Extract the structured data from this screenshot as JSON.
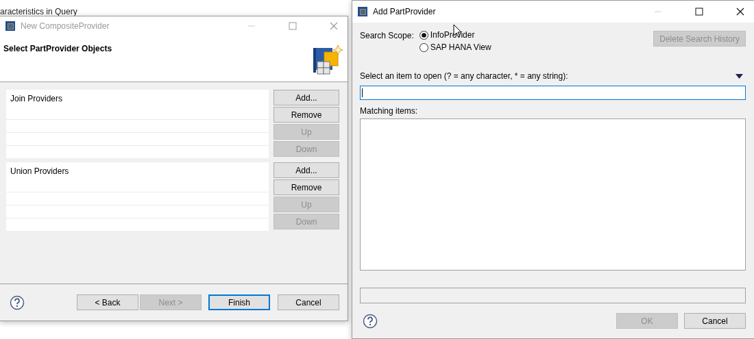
{
  "background_text": "aracteristics in Query",
  "wizard": {
    "title": "New CompositeProvider",
    "active": false,
    "heading": "Select PartProvider Objects",
    "sections": [
      {
        "label": "Join Providers",
        "buttons": [
          {
            "label": "Add...",
            "disabled": false
          },
          {
            "label": "Remove",
            "disabled": false
          },
          {
            "label": "Up",
            "disabled": true
          },
          {
            "label": "Down",
            "disabled": true
          }
        ]
      },
      {
        "label": "Union Providers",
        "buttons": [
          {
            "label": "Add...",
            "disabled": false
          },
          {
            "label": "Remove",
            "disabled": false
          },
          {
            "label": "Up",
            "disabled": true
          },
          {
            "label": "Down",
            "disabled": true
          }
        ]
      }
    ],
    "buttons": [
      {
        "label": "< Back",
        "disabled": false,
        "default": false
      },
      {
        "label": "Next >",
        "disabled": true,
        "default": false
      },
      {
        "label": "Finish",
        "disabled": false,
        "default": true
      },
      {
        "label": "Cancel",
        "disabled": false,
        "default": false
      }
    ]
  },
  "dialog": {
    "title": "Add PartProvider",
    "active": true,
    "search_scope_label": "Search Scope:",
    "scopes": [
      {
        "label": "InfoProvider",
        "selected": true
      },
      {
        "label": "SAP HANA View",
        "selected": false
      }
    ],
    "delete_history": {
      "label": "Delete Search History",
      "disabled": true
    },
    "pattern_label": "Select an item to open (? = any character, * = any string):",
    "matching_label": "Matching items:",
    "buttons": [
      {
        "label": "OK",
        "disabled": true,
        "default": false
      },
      {
        "label": "Cancel",
        "disabled": false,
        "default": false
      }
    ]
  }
}
